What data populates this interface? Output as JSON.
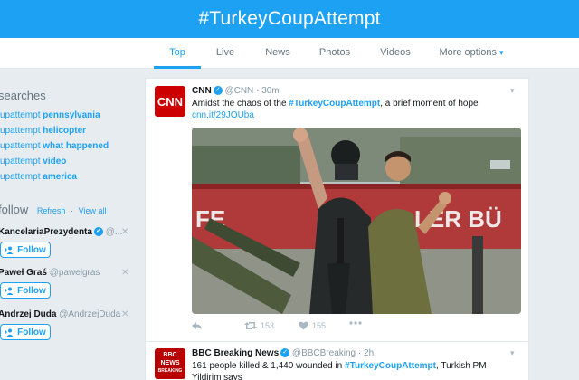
{
  "header": {
    "title": "#TurkeyCoupAttempt"
  },
  "tabs": [
    {
      "label": "Top",
      "active": true
    },
    {
      "label": "Live"
    },
    {
      "label": "News"
    },
    {
      "label": "Photos"
    },
    {
      "label": "Videos"
    },
    {
      "label": "More options"
    }
  ],
  "sidebar": {
    "searches_title": "searches",
    "searches": [
      {
        "prefix": "upattempt",
        "query": "pennsylvania"
      },
      {
        "prefix": "upattempt",
        "query": "helicopter"
      },
      {
        "prefix": "upattempt",
        "query": "what happened"
      },
      {
        "prefix": "upattempt",
        "query": "video"
      },
      {
        "prefix": "upattempt",
        "query": "america"
      }
    ],
    "follow_title": "follow",
    "refresh": "Refresh",
    "sep": "·",
    "view_all": "View all",
    "accounts": [
      {
        "name": "KancelariaPrezydenta",
        "handle": "@...",
        "follow": "Follow"
      },
      {
        "name": "Paweł Graś",
        "handle": "@pawelgras",
        "follow": "Follow"
      },
      {
        "name": "Andrzej Duda",
        "handle": "@AndrzejDuda",
        "follow": "Follow"
      }
    ]
  },
  "tweets": [
    {
      "name": "CNN",
      "handle": "@CNN",
      "time": "30m",
      "text_before": "Amidst the chaos of the ",
      "hashtag": "#TurkeyCoupAttempt",
      "text_after": ", a brief moment of hope",
      "link": "cnn.it/29JOUba",
      "retweets": "153",
      "likes": "155",
      "media_text_left": "FE",
      "media_text_right": "LER BÜ"
    },
    {
      "name": "BBC Breaking News",
      "handle": "@BBCBreaking",
      "time": "2h",
      "text_before": "161 people killed & 1,440 wounded in ",
      "hashtag": "#TurkeyCoupAttempt",
      "text_after": ", Turkish PM Yildirim says",
      "avatar_line1": "BBC",
      "avatar_line2": "NEWS",
      "avatar_line3": "BREAKING"
    }
  ],
  "colors": {
    "accent": "#1da1f2",
    "cnn_red": "#cc0000",
    "bbc_red": "#b80000"
  }
}
